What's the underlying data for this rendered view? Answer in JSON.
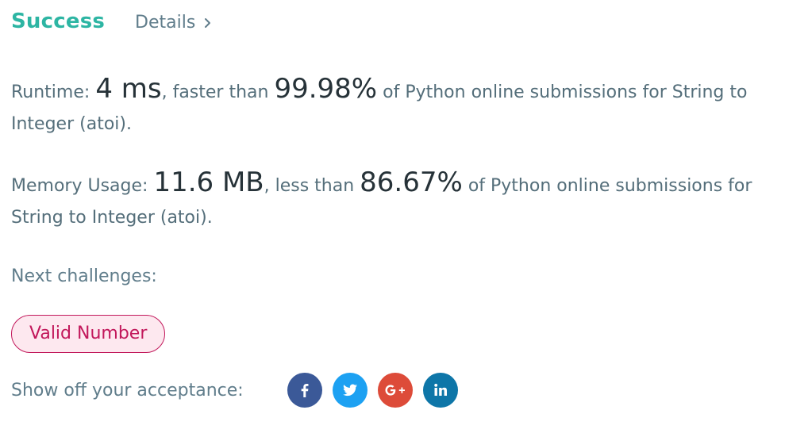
{
  "header": {
    "status": "Success",
    "details_label": "Details"
  },
  "runtime": {
    "label": "Runtime:",
    "value": "4 ms",
    "comparison": ", faster than",
    "percent": "99.98%",
    "suffix": "of Python online submissions for String to Integer (atoi)."
  },
  "memory": {
    "label": "Memory Usage:",
    "value": "11.6 MB",
    "comparison": ", less than",
    "percent": "86.67%",
    "suffix": "of Python online submissions for String to Integer (atoi)."
  },
  "next": {
    "label": "Next challenges:",
    "challenges": [
      "Valid Number"
    ]
  },
  "share": {
    "label": "Show off your acceptance:",
    "icons": [
      {
        "name": "facebook-icon",
        "color": "#3b5998"
      },
      {
        "name": "twitter-icon",
        "color": "#1da1f2"
      },
      {
        "name": "google-plus-icon",
        "color": "#dd4b39"
      },
      {
        "name": "linkedin-icon",
        "color": "#0e76a8"
      }
    ]
  },
  "colors": {
    "success": "#2db5a3",
    "challenge_border": "#c2185b",
    "challenge_bg": "#fde8ef"
  }
}
